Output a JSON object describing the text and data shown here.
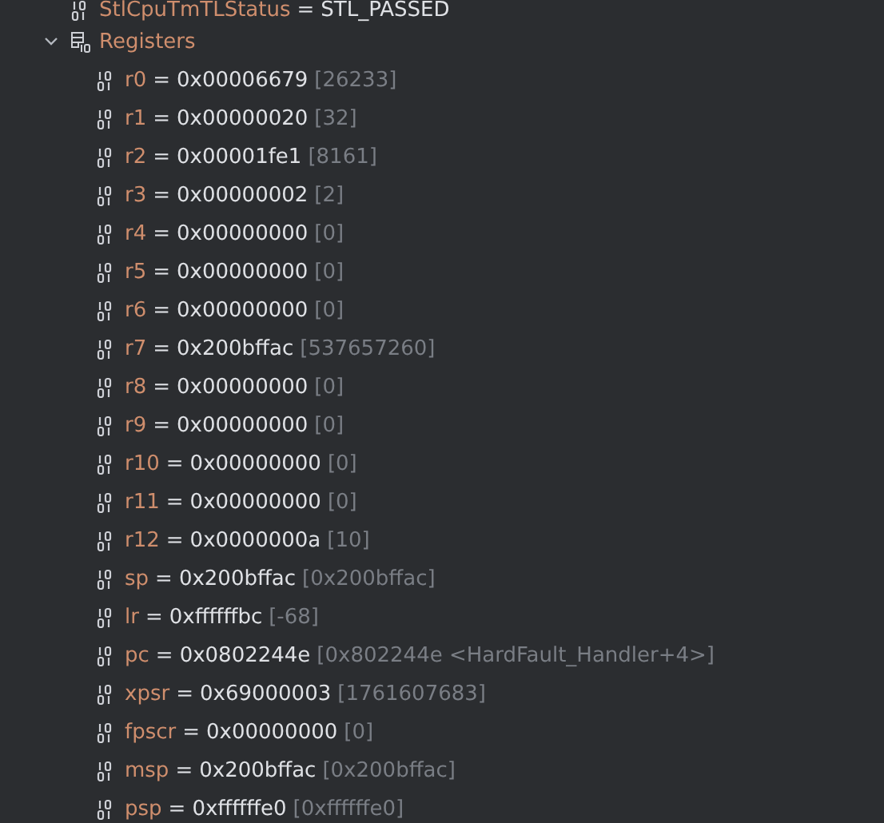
{
  "variables": [
    {
      "kind": "variable",
      "name": "StlCpuTmTLStatus",
      "sep": "=",
      "value": "STL_PASSED"
    },
    {
      "kind": "group",
      "name": "Registers",
      "expanded": true,
      "children": [
        {
          "name": "r0",
          "sep": "=",
          "value": "0x00006679",
          "detail": "[26233]"
        },
        {
          "name": "r1",
          "sep": "=",
          "value": "0x00000020",
          "detail": "[32]"
        },
        {
          "name": "r2",
          "sep": "=",
          "value": "0x00001fe1",
          "detail": "[8161]"
        },
        {
          "name": "r3",
          "sep": "=",
          "value": "0x00000002",
          "detail": "[2]"
        },
        {
          "name": "r4",
          "sep": "=",
          "value": "0x00000000",
          "detail": "[0]"
        },
        {
          "name": "r5",
          "sep": "=",
          "value": "0x00000000",
          "detail": "[0]"
        },
        {
          "name": "r6",
          "sep": "=",
          "value": "0x00000000",
          "detail": "[0]"
        },
        {
          "name": "r7",
          "sep": "=",
          "value": "0x200bffac",
          "detail": "[537657260]"
        },
        {
          "name": "r8",
          "sep": "=",
          "value": "0x00000000",
          "detail": "[0]"
        },
        {
          "name": "r9",
          "sep": "=",
          "value": "0x00000000",
          "detail": "[0]"
        },
        {
          "name": "r10",
          "sep": "=",
          "value": "0x00000000",
          "detail": "[0]"
        },
        {
          "name": "r11",
          "sep": "=",
          "value": "0x00000000",
          "detail": "[0]"
        },
        {
          "name": "r12",
          "sep": "=",
          "value": "0x0000000a",
          "detail": "[10]"
        },
        {
          "name": "sp",
          "sep": "=",
          "value": "0x200bffac",
          "detail": "[0x200bffac]"
        },
        {
          "name": "lr",
          "sep": "=",
          "value": "0xffffffbc",
          "detail": "[-68]"
        },
        {
          "name": "pc",
          "sep": "=",
          "value": "0x0802244e",
          "detail": "[0x802244e <HardFault_Handler+4>]"
        },
        {
          "name": "xpsr",
          "sep": "=",
          "value": "0x69000003",
          "detail": "[1761607683]"
        },
        {
          "name": "fpscr",
          "sep": "=",
          "value": "0x00000000",
          "detail": "[0]"
        },
        {
          "name": "msp",
          "sep": "=",
          "value": "0x200bffac",
          "detail": "[0x200bffac]"
        },
        {
          "name": "psp",
          "sep": "=",
          "value": "0xffffffe0",
          "detail": "[0xffffffe0]"
        }
      ]
    }
  ]
}
